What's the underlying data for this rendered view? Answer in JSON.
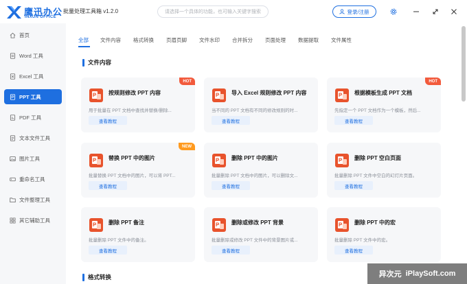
{
  "app": {
    "logo_cn": "鹰迅办公",
    "logo_en": "INXUN OFFICE",
    "title": "批量处理工具箱 v1.2.0",
    "search_placeholder": "请选择一个具体的功能，也可输入关键字搜索",
    "login_label": "登录/注册"
  },
  "colors": {
    "accent": "#1e6fe0",
    "hot": "#f25a3c",
    "new": "#ff9a1f",
    "ppt": "#e8532c"
  },
  "sidebar": {
    "items": [
      {
        "label": "首页",
        "icon": "home-icon"
      },
      {
        "label": "Word 工具",
        "icon": "word-icon"
      },
      {
        "label": "Excel 工具",
        "icon": "excel-icon"
      },
      {
        "label": "PPT 工具",
        "icon": "ppt-icon",
        "active": true
      },
      {
        "label": "PDF 工具",
        "icon": "pdf-icon"
      },
      {
        "label": "文本文件工具",
        "icon": "text-file-icon"
      },
      {
        "label": "图片工具",
        "icon": "image-icon"
      },
      {
        "label": "重命名工具",
        "icon": "rename-icon"
      },
      {
        "label": "文件整理工具",
        "icon": "folder-icon"
      },
      {
        "label": "其它辅助工具",
        "icon": "tools-icon"
      }
    ]
  },
  "tabs": [
    {
      "label": "全部",
      "active": true
    },
    {
      "label": "文件内容"
    },
    {
      "label": "格式转换"
    },
    {
      "label": "页眉页脚"
    },
    {
      "label": "文件水印"
    },
    {
      "label": "合并拆分"
    },
    {
      "label": "页面处理"
    },
    {
      "label": "数据提取"
    },
    {
      "label": "文件属性"
    }
  ],
  "sections": [
    {
      "title": "文件内容"
    },
    {
      "title": "格式转换"
    }
  ],
  "cards": [
    {
      "title": "按规则修改 PPT 内容",
      "desc": "用于批量在 PPT 文档中查找并替换/删除...",
      "button": "查看教程",
      "badge": "HOT"
    },
    {
      "title": "导入 Excel 规则修改 PPT 内容",
      "desc": "当不同的 PPT 文档有不同的修改规则的时...",
      "button": "查看教程",
      "badge": ""
    },
    {
      "title": "根据模板生成 PPT 文档",
      "desc": "先指定一个 PPT 文档作为一个模板，然后...",
      "button": "查看教程",
      "badge": "HOT"
    },
    {
      "title": "替换 PPT 中的图片",
      "desc": "批量替换 PPT 文档中的图片，可以将 PPT...",
      "button": "查看教程",
      "badge": "NEW"
    },
    {
      "title": "删除 PPT 中的图片",
      "desc": "批量删除 PPT 文档中的图片，可以删除文...",
      "button": "查看教程",
      "badge": ""
    },
    {
      "title": "删除 PPT 空白页面",
      "desc": "批量删除 PPT 文件中空白的幻灯片页面。",
      "button": "查看教程",
      "badge": ""
    },
    {
      "title": "删除 PPT 备注",
      "desc": "批量删除 PPT 文件中的备注。",
      "button": "查看教程",
      "badge": ""
    },
    {
      "title": "删除或修改 PPT 背景",
      "desc": "批量删除或修改 PPT 文件中的背景图片或...",
      "button": "查看教程",
      "badge": ""
    },
    {
      "title": "删除 PPT 中的宏",
      "desc": "批量删除 PPT 文件中的宏。",
      "button": "查看教程",
      "badge": ""
    }
  ],
  "watermark": {
    "text_cn": "异次元",
    "text_en": "iPlaySoft.com"
  }
}
